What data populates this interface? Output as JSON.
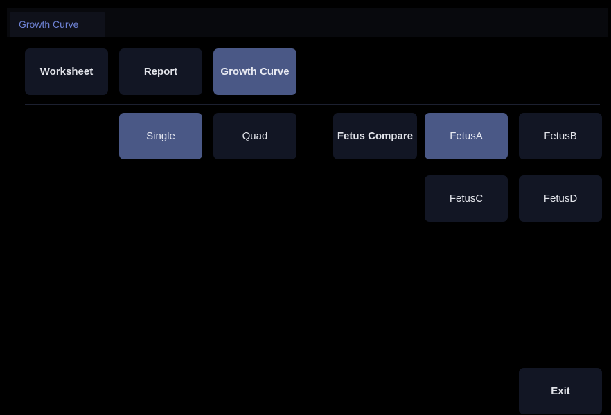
{
  "tabs": [
    {
      "label": "Growth Curve",
      "active": true
    }
  ],
  "nav": {
    "worksheet": "Worksheet",
    "report": "Report",
    "growth_curve": "Growth Curve",
    "active": "growth_curve"
  },
  "layout_mode": {
    "single": "Single",
    "quad": "Quad",
    "active": "single"
  },
  "fetus": {
    "compare": "Fetus Compare",
    "a": "FetusA",
    "b": "FetusB",
    "c": "FetusC",
    "d": "FetusD",
    "active": "a"
  },
  "exit": "Exit",
  "colors": {
    "background": "#000000",
    "button": "#121624",
    "button_active": "#4a5886",
    "tab_text": "#6f83d6"
  }
}
